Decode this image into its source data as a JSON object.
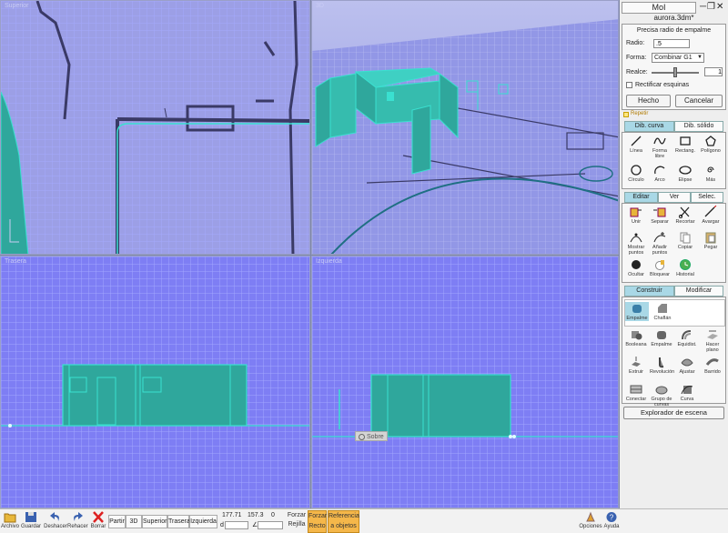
{
  "viewports": {
    "superior": "Superior",
    "threed": "3D",
    "trasera": "Trasera",
    "izquierda": "Izquierda",
    "snap_label": "Sobre"
  },
  "app": {
    "title": "MoI",
    "filename": "aurora.3dm*"
  },
  "fillet": {
    "heading": "Precisa radio de empalme",
    "radio_label": "Radio:",
    "radio_value": ".5",
    "forma_label": "Forma:",
    "forma_value": "Combinar G1",
    "realce_label": "Realce:",
    "realce_value": "1",
    "rectificar_label": "Rectificar esquinas",
    "hecho": "Hecho",
    "cancelar": "Cancelar",
    "repetir": "Repetir"
  },
  "draw_tabs": {
    "curva": "Dib. curva",
    "solido": "Dib. sólido"
  },
  "draw_tools": [
    "Línea",
    "Forma libre",
    "Rectang.",
    "Polígono",
    "Círculo",
    "Arco",
    "Elipse",
    "Más"
  ],
  "edit_tabs": {
    "editar": "Editar",
    "ver": "Ver",
    "selec": "Selec."
  },
  "edit_tools": [
    "Unir",
    "Separar",
    "Recortar",
    "Avargar",
    "Mostrar puntos",
    "Añadir puntos",
    "Copiar",
    "Pegar",
    "Ocultar",
    "Bloquear",
    "Historial"
  ],
  "build_tabs": {
    "construir": "Construir",
    "modificar": "Modificar"
  },
  "build_flyout": [
    "Empalme",
    "Chaflán"
  ],
  "build_tools": [
    "Booleana",
    "Empalme",
    "Equidist.",
    "Hacer plano",
    "Extruir",
    "Revolución",
    "Ajustar",
    "Barrido",
    "Conectar",
    "Grupo de curvas",
    "Curva"
  ],
  "scene_browser": "Explorador de escena",
  "bottom": {
    "archivo": "Archivo",
    "guardar": "Guardar",
    "deshacer": "Deshacer",
    "rehacer": "Rehacer",
    "borrar": "Borrar",
    "views": [
      "Partir",
      "3D",
      "Superior",
      "Trasera",
      "Izquierda"
    ],
    "coords": [
      "177.71",
      "157.3",
      "0"
    ],
    "d_label": "d",
    "angle_label": "∠",
    "forzar_rejilla": "Forzar Rejilla",
    "forzar_recto": "Forzar Recto",
    "referencia": "Referencia a objetos",
    "opciones": "Opciones",
    "ayuda": "Ayuda"
  },
  "colors": {
    "accent": "#3ae0d0",
    "surface": "#2fa79c",
    "active_tab": "#a9d8e6",
    "snap_toggle": "#f5b74a"
  }
}
